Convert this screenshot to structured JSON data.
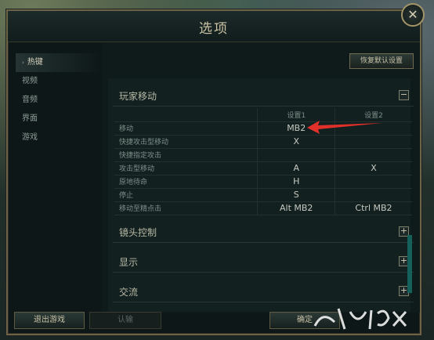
{
  "window": {
    "title": "选项",
    "close_glyph": "✕"
  },
  "sidebar": {
    "items": [
      {
        "label": "热键",
        "active": true
      },
      {
        "label": "视频"
      },
      {
        "label": "音频"
      },
      {
        "label": "界面"
      },
      {
        "label": "游戏"
      }
    ]
  },
  "main": {
    "restore_label": "恢复默认设置",
    "sections": [
      {
        "title": "玩家移动",
        "toggle": "−"
      },
      {
        "title": "镜头控制",
        "toggle": "+"
      },
      {
        "title": "显示",
        "toggle": "+"
      },
      {
        "title": "交流",
        "toggle": "+"
      }
    ],
    "columns": [
      "设置1",
      "设置2"
    ],
    "rows": [
      {
        "action": "移动",
        "key1": "MB2",
        "key2": ""
      },
      {
        "action": "快捷攻击型移动",
        "key1": "X",
        "key2": ""
      },
      {
        "action": "快捷指定攻击",
        "key1": "",
        "key2": ""
      },
      {
        "action": "攻击型移动",
        "key1": "A",
        "key2": "X"
      },
      {
        "action": "原地待命",
        "key1": "H",
        "key2": ""
      },
      {
        "action": "停止",
        "key1": "S",
        "key2": ""
      },
      {
        "action": "移动至精点击",
        "key1": "Alt MB2",
        "key2": "Ctrl MB2"
      }
    ]
  },
  "footer": {
    "exit_label": "退出游戏",
    "confirm_label": "认输",
    "ok_label": "确定"
  },
  "colors": {
    "annotation_arrow": "#e0302a",
    "accent": "#14605a"
  }
}
